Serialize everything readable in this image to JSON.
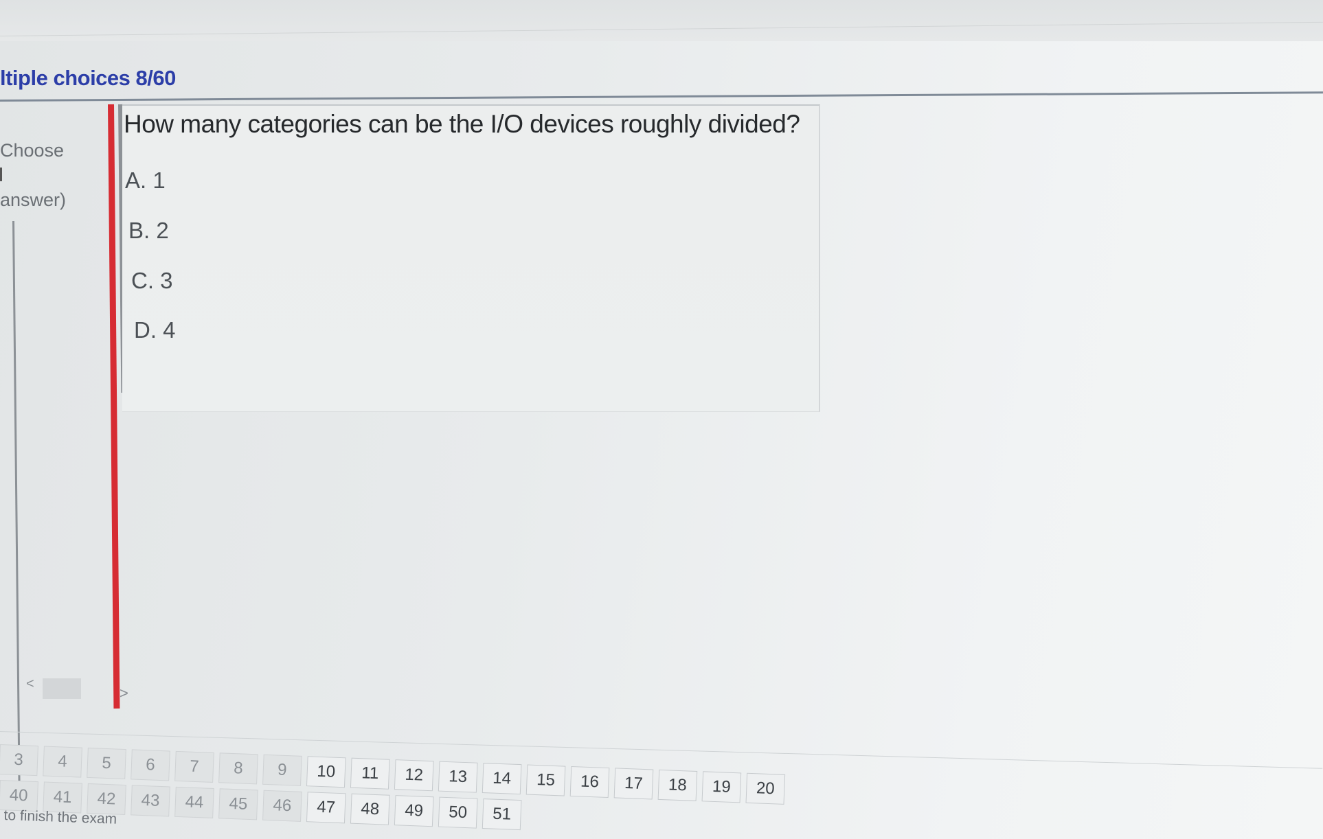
{
  "header": {
    "section_title": "ltiple choices 8/60"
  },
  "left_panel": {
    "choose_label": "Choose",
    "answer_hint": "answer)",
    "scroll_left": "<",
    "scroll_right": ">"
  },
  "question": {
    "text": "How many categories can be the I/O devices roughly divided?",
    "options": [
      {
        "label": "A. 1"
      },
      {
        "label": "B. 2"
      },
      {
        "label": "C. 3"
      },
      {
        "label": "D. 4"
      }
    ]
  },
  "navigation": {
    "row1": [
      "3",
      "4",
      "5",
      "6",
      "7",
      "8",
      "9",
      "10",
      "11",
      "12",
      "13",
      "14",
      "15",
      "16",
      "17",
      "18",
      "19",
      "20"
    ],
    "row2": [
      "40",
      "41",
      "42",
      "43",
      "44",
      "45",
      "46",
      "47",
      "48",
      "49",
      "50",
      "51"
    ],
    "finish_text": "to finish the exam"
  },
  "colors": {
    "title": "#2c3ea8",
    "red_marker": "#d62c33",
    "card_background": "#eceeee"
  }
}
